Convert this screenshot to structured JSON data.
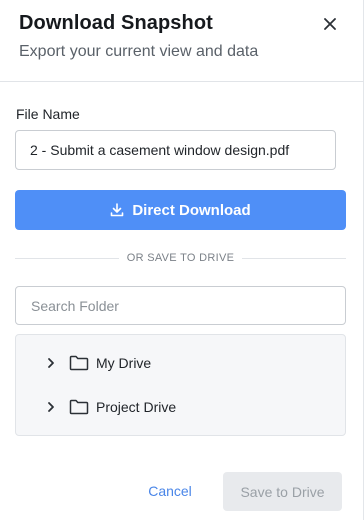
{
  "dialog": {
    "title": "Download Snapshot",
    "subtitle": "Export your current view and data",
    "close_icon": "close-icon"
  },
  "file_name": {
    "label": "File Name",
    "value": "2 - Submit a casement window design.pdf"
  },
  "direct_download": {
    "label": "Direct Download",
    "icon": "download-icon",
    "color": "#4f8ff7"
  },
  "divider": {
    "text": "OR SAVE TO DRIVE"
  },
  "search": {
    "placeholder": "Search Folder",
    "value": ""
  },
  "folders": [
    {
      "label": "My Drive",
      "expand_icon": "chevron-right-icon",
      "icon": "folder-icon"
    },
    {
      "label": "Project Drive",
      "expand_icon": "chevron-right-icon",
      "icon": "folder-icon"
    }
  ],
  "footer": {
    "cancel_label": "Cancel",
    "save_label": "Save to Drive",
    "save_disabled": true
  }
}
